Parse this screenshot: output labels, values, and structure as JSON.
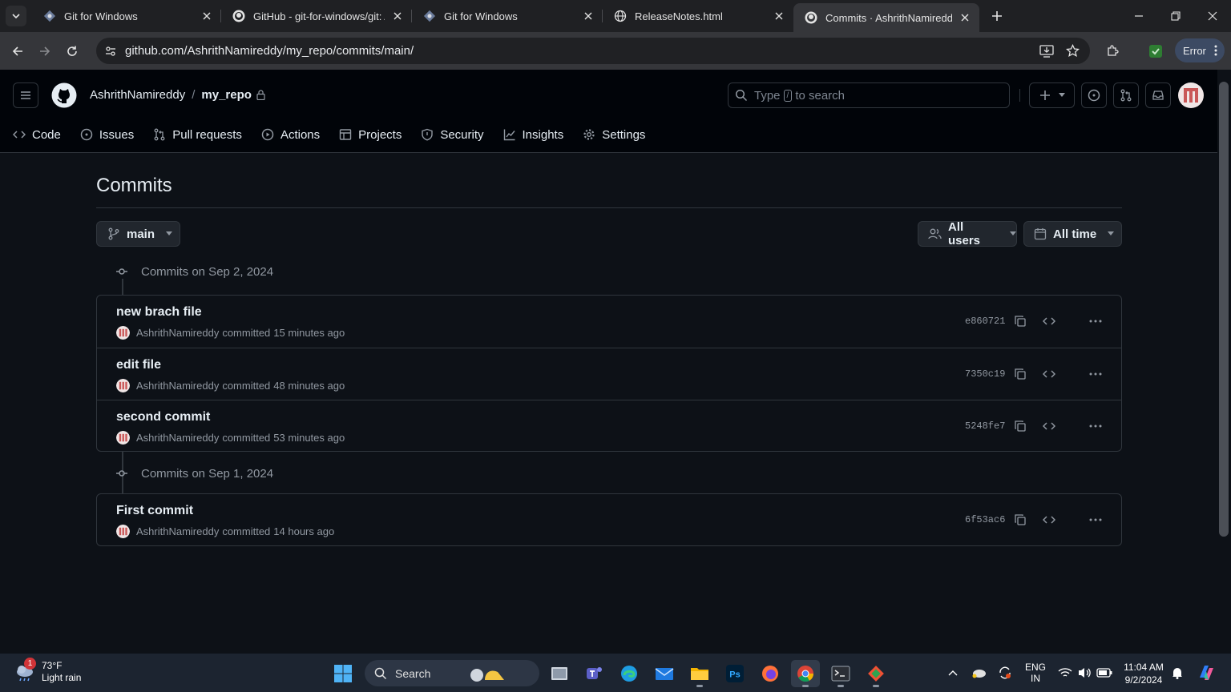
{
  "browser": {
    "tabs": [
      {
        "title": "Git for Windows",
        "active": false
      },
      {
        "title": "GitHub - git-for-windows/git: A",
        "active": false
      },
      {
        "title": "Git for Windows",
        "active": false
      },
      {
        "title": "ReleaseNotes.html",
        "active": false
      },
      {
        "title": "Commits · AshrithNamireddy/m",
        "active": true
      }
    ],
    "url": "github.com/AshrithNamireddy/my_repo/commits/main/",
    "profile_status": "Error"
  },
  "github": {
    "owner": "AshrithNamireddy",
    "separator": "/",
    "repo": "my_repo",
    "search_prefix": "Type",
    "search_key": "/",
    "search_suffix": "to search",
    "repo_nav": [
      "Code",
      "Issues",
      "Pull requests",
      "Actions",
      "Projects",
      "Security",
      "Insights",
      "Settings"
    ]
  },
  "commits_page": {
    "title": "Commits",
    "branch": "main",
    "users_filter": "All users",
    "time_filter": "All time",
    "groups": [
      {
        "heading": "Commits on Sep 2, 2024",
        "commits": [
          {
            "message": "new brach file",
            "author": "AshrithNamireddy",
            "action": "committed",
            "time": "15 minutes ago",
            "sha": "e860721"
          },
          {
            "message": "edit file",
            "author": "AshrithNamireddy",
            "action": "committed",
            "time": "48 minutes ago",
            "sha": "7350c19"
          },
          {
            "message": "second commit",
            "author": "AshrithNamireddy",
            "action": "committed",
            "time": "53 minutes ago",
            "sha": "5248fe7"
          }
        ]
      },
      {
        "heading": "Commits on Sep 1, 2024",
        "commits": [
          {
            "message": "First commit",
            "author": "AshrithNamireddy",
            "action": "committed",
            "time": "14 hours ago",
            "sha": "6f53ac6"
          }
        ]
      }
    ]
  },
  "taskbar": {
    "weather_temp": "73°F",
    "weather_desc": "Light rain",
    "weather_badge": "1",
    "search_label": "Search",
    "lang_line1": "ENG",
    "lang_line2": "IN",
    "time": "11:04 AM",
    "date": "9/2/2024"
  },
  "colors": {
    "page_bg": "#0d1117",
    "header_bg": "#010409",
    "border": "#30363d",
    "text": "#e6edf3",
    "muted": "#9198a1"
  }
}
